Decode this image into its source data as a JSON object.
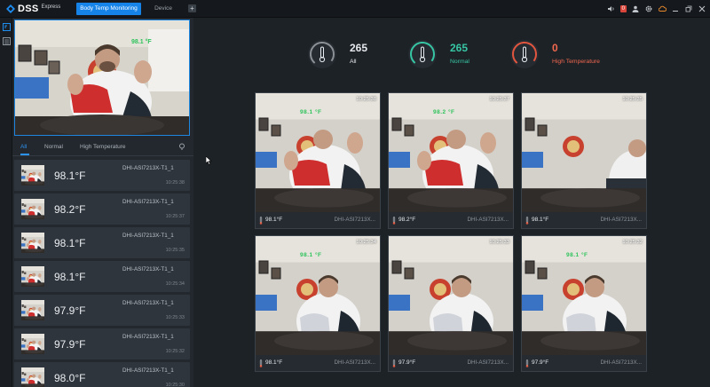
{
  "app": {
    "name": "DSS",
    "edition": "Express",
    "tabs": [
      {
        "label": "Body Temp Monitoring",
        "active": true
      },
      {
        "label": "Device",
        "active": false
      }
    ],
    "alarm_count": "0",
    "accent": "#1683e8"
  },
  "toolbar_icons": [
    "speaker-icon",
    "user-icon",
    "settings-icon",
    "cloud-icon",
    "minimize-icon",
    "restore-icon",
    "close-icon"
  ],
  "rail_icons": [
    "monitor-icon",
    "list-icon"
  ],
  "preview": {
    "overlay_temp": "98.1 °F"
  },
  "filter": {
    "tabs": [
      "All",
      "Normal",
      "High Temperature"
    ],
    "active": "All"
  },
  "records": [
    {
      "temp": "98.1°F",
      "device": "DHI-ASI7213X-T1_1",
      "time": "10:25:38"
    },
    {
      "temp": "98.2°F",
      "device": "DHI-ASI7213X-T1_1",
      "time": "10:25:37"
    },
    {
      "temp": "98.1°F",
      "device": "DHI-ASI7213X-T1_1",
      "time": "10:25:35"
    },
    {
      "temp": "98.1°F",
      "device": "DHI-ASI7213X-T1_1",
      "time": "10:25:34"
    },
    {
      "temp": "97.9°F",
      "device": "DHI-ASI7213X-T1_1",
      "time": "10:25:33"
    },
    {
      "temp": "97.9°F",
      "device": "DHI-ASI7213X-T1_1",
      "time": "10:25:32"
    },
    {
      "temp": "98.0°F",
      "device": "DHI-ASI7213X-T1_1",
      "time": "10:25:30"
    }
  ],
  "stats": [
    {
      "count": "265",
      "label": "All",
      "color": "#e6e9ec",
      "ring": "#8a9096"
    },
    {
      "count": "265",
      "label": "Normal",
      "color": "#37c6a4",
      "ring": "#37c6a4"
    },
    {
      "count": "0",
      "label": "High Temperature",
      "color": "#f2684e",
      "ring": "#e2553f"
    }
  ],
  "tiles": [
    {
      "time": "10:25:38",
      "overlay": "98.1 °F",
      "temp": "98.1°F",
      "device": "DHI-ASI7213X...",
      "pose": "wave"
    },
    {
      "time": "10:25:37",
      "overlay": "98.2 °F",
      "temp": "98.2°F",
      "device": "DHI-ASI7213X...",
      "pose": "wave"
    },
    {
      "time": "10:25:35",
      "overlay": "",
      "temp": "98.1°F",
      "device": "DHI-ASI7213X...",
      "pose": "side"
    },
    {
      "time": "10:25:34",
      "overlay": "98.1 °F",
      "temp": "98.1°F",
      "device": "DHI-ASI7213X...",
      "pose": "front"
    },
    {
      "time": "10:25:33",
      "overlay": "",
      "temp": "97.9°F",
      "device": "DHI-ASI7213X...",
      "pose": "front"
    },
    {
      "time": "10:25:32",
      "overlay": "98.1 °F",
      "temp": "97.9°F",
      "device": "DHI-ASI7213X...",
      "pose": "front"
    }
  ]
}
